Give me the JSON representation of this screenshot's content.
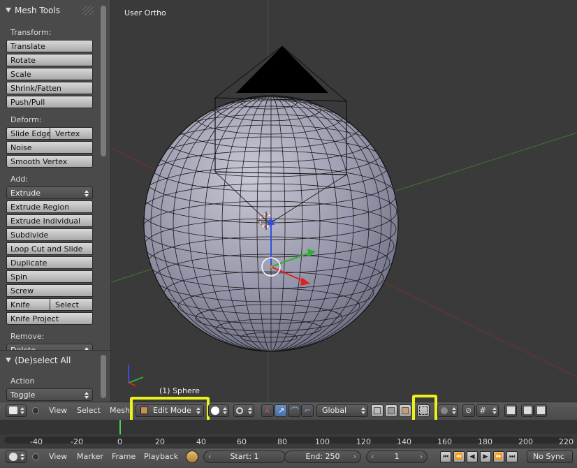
{
  "tool_panel": {
    "title": "Mesh Tools",
    "transform": {
      "label": "Transform:",
      "buttons": [
        "Translate",
        "Rotate",
        "Scale",
        "Shrink/Fatten",
        "Push/Pull"
      ]
    },
    "deform": {
      "label": "Deform:",
      "slide_edge": "Slide Edge",
      "vertex": "Vertex",
      "noise": "Noise",
      "smooth_vertex": "Smooth Vertex"
    },
    "add": {
      "label": "Add:",
      "extrude_dropdown": "Extrude",
      "buttons": [
        "Extrude Region",
        "Extrude Individual",
        "Subdivide",
        "Loop Cut and Slide",
        "Duplicate",
        "Spin",
        "Screw"
      ],
      "knife": "Knife",
      "select": "Select",
      "knife_project": "Knife Project"
    },
    "remove": {
      "label": "Remove:",
      "delete": "Delete"
    }
  },
  "operator_panel": {
    "title": "(De)select All",
    "action_label": "Action",
    "action_value": "Toggle"
  },
  "viewport": {
    "view_name": "User Ortho",
    "object_label": "(1) Sphere"
  },
  "header": {
    "menus": [
      "View",
      "Select",
      "Mesh"
    ],
    "mode": "Edit Mode",
    "orientation": "Global"
  },
  "timeline": {
    "ticks": [
      "-40",
      "-20",
      "0",
      "20",
      "40",
      "60",
      "80",
      "100",
      "120",
      "140",
      "160",
      "180",
      "200",
      "220"
    ],
    "current_frame_marker": 0
  },
  "bottom_bar": {
    "menus": [
      "View",
      "Marker",
      "Frame",
      "Playback"
    ],
    "start": "Start: 1",
    "end": "End: 250",
    "current_frame": "1",
    "sync": "No Sync"
  },
  "colors": {
    "highlight": "#eaf21a",
    "viewport_bg": "#3a3a3a",
    "panel_bg": "#4a4a4a"
  }
}
